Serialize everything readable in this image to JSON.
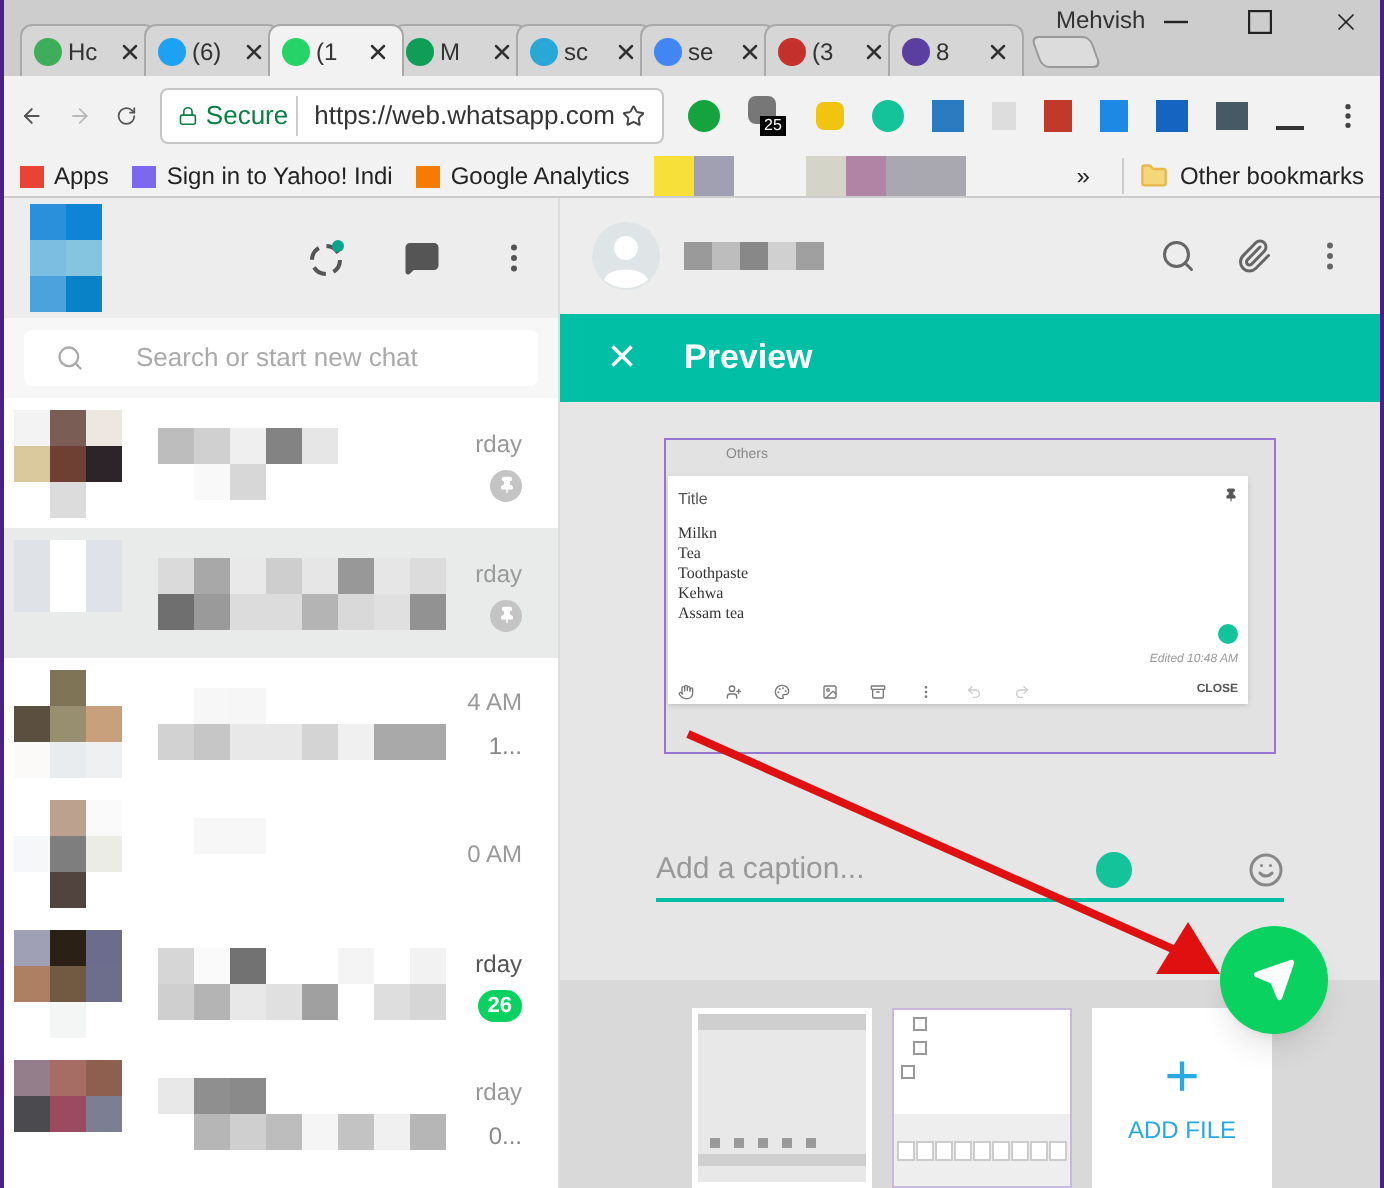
{
  "browser": {
    "profile": "Mehvish",
    "tabs": [
      {
        "label": "Hc",
        "color": "#3fae5a",
        "selected": false
      },
      {
        "label": "(6)",
        "color": "#1da1f2",
        "selected": false
      },
      {
        "label": "(1",
        "color": "#25d366",
        "selected": true
      },
      {
        "label": "M",
        "color": "#0f9d58",
        "selected": false
      },
      {
        "label": "sc",
        "color": "#29a8d8",
        "selected": false
      },
      {
        "label": "se",
        "color": "#4285f4",
        "selected": false
      },
      {
        "label": "(3",
        "color": "#c4302b",
        "selected": false
      },
      {
        "label": "8",
        "color": "#5b3fa0",
        "selected": false
      }
    ],
    "security": "Secure",
    "url": "https://web.whatsapp.com",
    "extension_badge": "25",
    "bookmarks": [
      {
        "label": "Apps",
        "color": "#e94335"
      },
      {
        "label": "Sign in to Yahoo! Indi",
        "color": "#7b68ee"
      },
      {
        "label": "Google Analytics",
        "color": "#f57c00"
      }
    ],
    "bookmarks_overflow": "»",
    "other_bookmarks": "Other bookmarks"
  },
  "sidebar": {
    "search": {
      "placeholder": "Search or start new chat"
    },
    "chats": [
      {
        "time": "rday",
        "pinned": true,
        "selected": false
      },
      {
        "time": "rday",
        "pinned": true,
        "selected": true
      },
      {
        "time": "4 AM",
        "preview": "1...",
        "pinned": false,
        "selected": false
      },
      {
        "time": "0 AM",
        "pinned": false,
        "selected": false
      },
      {
        "time": "rday",
        "badge": "26",
        "pinned": false,
        "selected": false
      },
      {
        "time": "rday",
        "preview": "0...",
        "pinned": false,
        "selected": false
      }
    ]
  },
  "preview": {
    "close": "×",
    "title": "Preview",
    "image": {
      "section": "Others",
      "note_title": "Title",
      "lines": [
        "Milkn",
        "Tea",
        "Toothpaste",
        "Kehwa",
        "Assam tea"
      ],
      "edited": "Edited 10:48 AM",
      "close": "CLOSE"
    },
    "caption": {
      "placeholder": "Add a caption..."
    },
    "thumbnails": [
      {
        "kind": "screenshot",
        "selected": true
      },
      {
        "kind": "keyboard",
        "selected": false
      }
    ],
    "add_file": {
      "icon": "+",
      "label": "ADD FILE"
    }
  }
}
